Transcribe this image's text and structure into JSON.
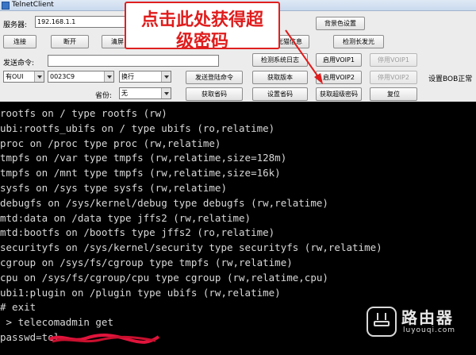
{
  "window": {
    "title": "TelnetClient"
  },
  "toolbar": {
    "server_label": "服务器:",
    "server_value": "192.168.1.1",
    "connect_label": "连接",
    "disconnect_label": "断开",
    "clear_label": "清屏",
    "bg_color_label": "背景色设置",
    "optical_info_label": "光猫信息",
    "detect_long_light_label": "检测长发光",
    "send_cmd_label": "发送命令:",
    "send_cmd_value": "",
    "detect_system_label": "检测系统日志",
    "enable_voip1_label": "启用VOIP1",
    "disable_voip1_label": "停用VOIP1",
    "oui_select": "有OUI",
    "code_select": "0023C9",
    "newline_select": "换行",
    "send_login_label": "发送登陆命令",
    "get_version_label": "获取版本",
    "enable_voip2_label": "启用VOIP2",
    "disable_voip2_label": "停用VOIP2",
    "set_bob_label": "设置BOB正常",
    "province_label": "省份:",
    "province_select": "无",
    "get_province_label": "获取省码",
    "set_province_label": "设置省码",
    "get_super_pwd_label": "获取超级密码",
    "reset_label": "复位"
  },
  "annotation": {
    "line1": "点击此处获得超",
    "line2": "级密码",
    "color": "#e01c1c"
  },
  "terminal": {
    "lines": [
      "rootfs on / type rootfs (rw)",
      "ubi:rootfs_ubifs on / type ubifs (ro,relatime)",
      "proc on /proc type proc (rw,relatime)",
      "tmpfs on /var type tmpfs (rw,relatime,size=128m)",
      "tmpfs on /mnt type tmpfs (rw,relatime,size=16k)",
      "sysfs on /sys type sysfs (rw,relatime)",
      "debugfs on /sys/kernel/debug type debugfs (rw,relatime)",
      "mtd:data on /data type jffs2 (rw,relatime)",
      "mtd:bootfs on /bootfs type jffs2 (ro,relatime)",
      "securityfs on /sys/kernel/security type securityfs (rw,relatime)",
      "cgroup on /sys/fs/cgroup type tmpfs (rw,relatime)",
      "cpu on /sys/fs/cgroup/cpu type cgroup (rw,relatime,cpu)",
      "ubi1:plugin on /plugin type ubifs (rw,relatime)",
      "# exit",
      " > telecomadmin get",
      "passwd=tel"
    ]
  },
  "watermark": {
    "name_cn": "路由器",
    "name_en": "luyouqi.com"
  }
}
